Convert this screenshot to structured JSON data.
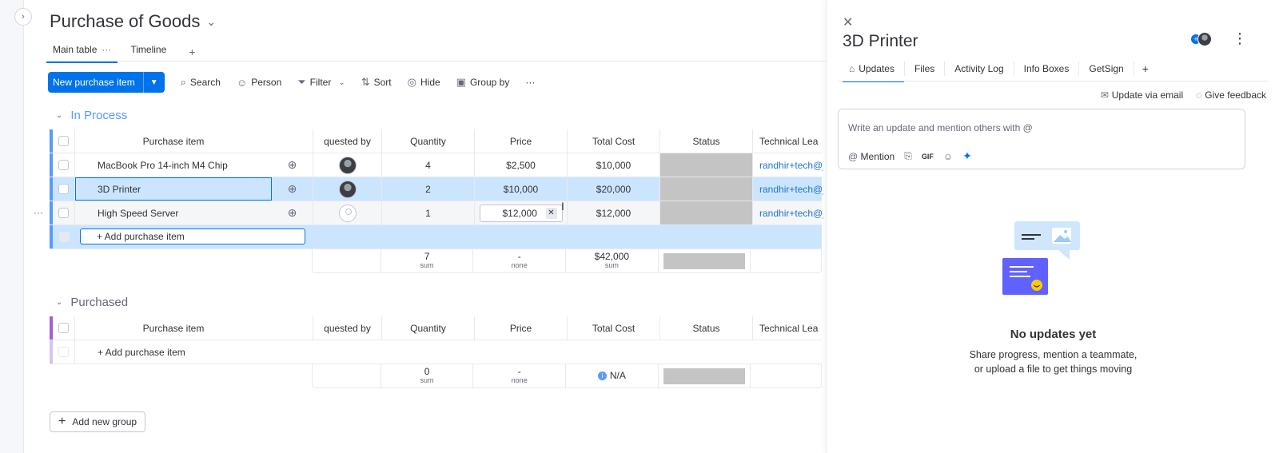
{
  "board": {
    "title": "Purchase of Goods",
    "view_tabs": [
      {
        "label": "Main table",
        "more": "···"
      },
      {
        "label": "Timeline"
      }
    ],
    "add_view": "+"
  },
  "toolbar": {
    "new_item": "New purchase item",
    "search": "Search",
    "person": "Person",
    "filter": "Filter",
    "sort": "Sort",
    "hide": "Hide",
    "group_by": "Group by",
    "more": "···"
  },
  "columns": {
    "purchase_item": "Purchase item",
    "requested_by": "quested by",
    "quantity": "Quantity",
    "price": "Price",
    "total_cost": "Total Cost",
    "status": "Status",
    "technical_lead": "Technical Lea"
  },
  "groups": [
    {
      "name": "In Process",
      "color": "#579bfc",
      "items": [
        {
          "name": "MacBook Pro 14-inch M4 Chip",
          "quantity": "4",
          "price": "$2,500",
          "total": "$10,000",
          "tech": "randhir+tech@j"
        },
        {
          "name": "3D Printer",
          "quantity": "2",
          "price": "$10,000",
          "total": "$20,000",
          "tech": "randhir+tech@j"
        },
        {
          "name": "High Speed Server",
          "quantity": "1",
          "price": "$12,000",
          "total": "$12,000",
          "tech": "randhir+tech@j"
        }
      ],
      "add_item": "+ Add purchase item",
      "summary": {
        "quantity": "7",
        "quantity_label": "sum",
        "price": "-",
        "price_label": "none",
        "total": "$42,000",
        "total_label": "sum"
      }
    },
    {
      "name": "Purchased",
      "color": "#a25ddc",
      "items": [],
      "add_item": "+ Add purchase item",
      "summary": {
        "quantity": "0",
        "quantity_label": "sum",
        "price": "-",
        "price_label": "none",
        "total": "N/A"
      }
    }
  ],
  "add_group": "Add new group",
  "panel": {
    "title": "3D Printer",
    "tabs": [
      "Updates",
      "Files",
      "Activity Log",
      "Info Boxes",
      "GetSign"
    ],
    "add_tab": "+",
    "update_via_email": "Update via email",
    "give_feedback": "Give feedback",
    "compose_placeholder": "Write an update and mention others with @",
    "mention": "Mention",
    "gif": "GIF",
    "empty_title": "No updates yet",
    "empty_line1": "Share progress, mention a teammate,",
    "empty_line2": "or upload a file to get things moving"
  }
}
